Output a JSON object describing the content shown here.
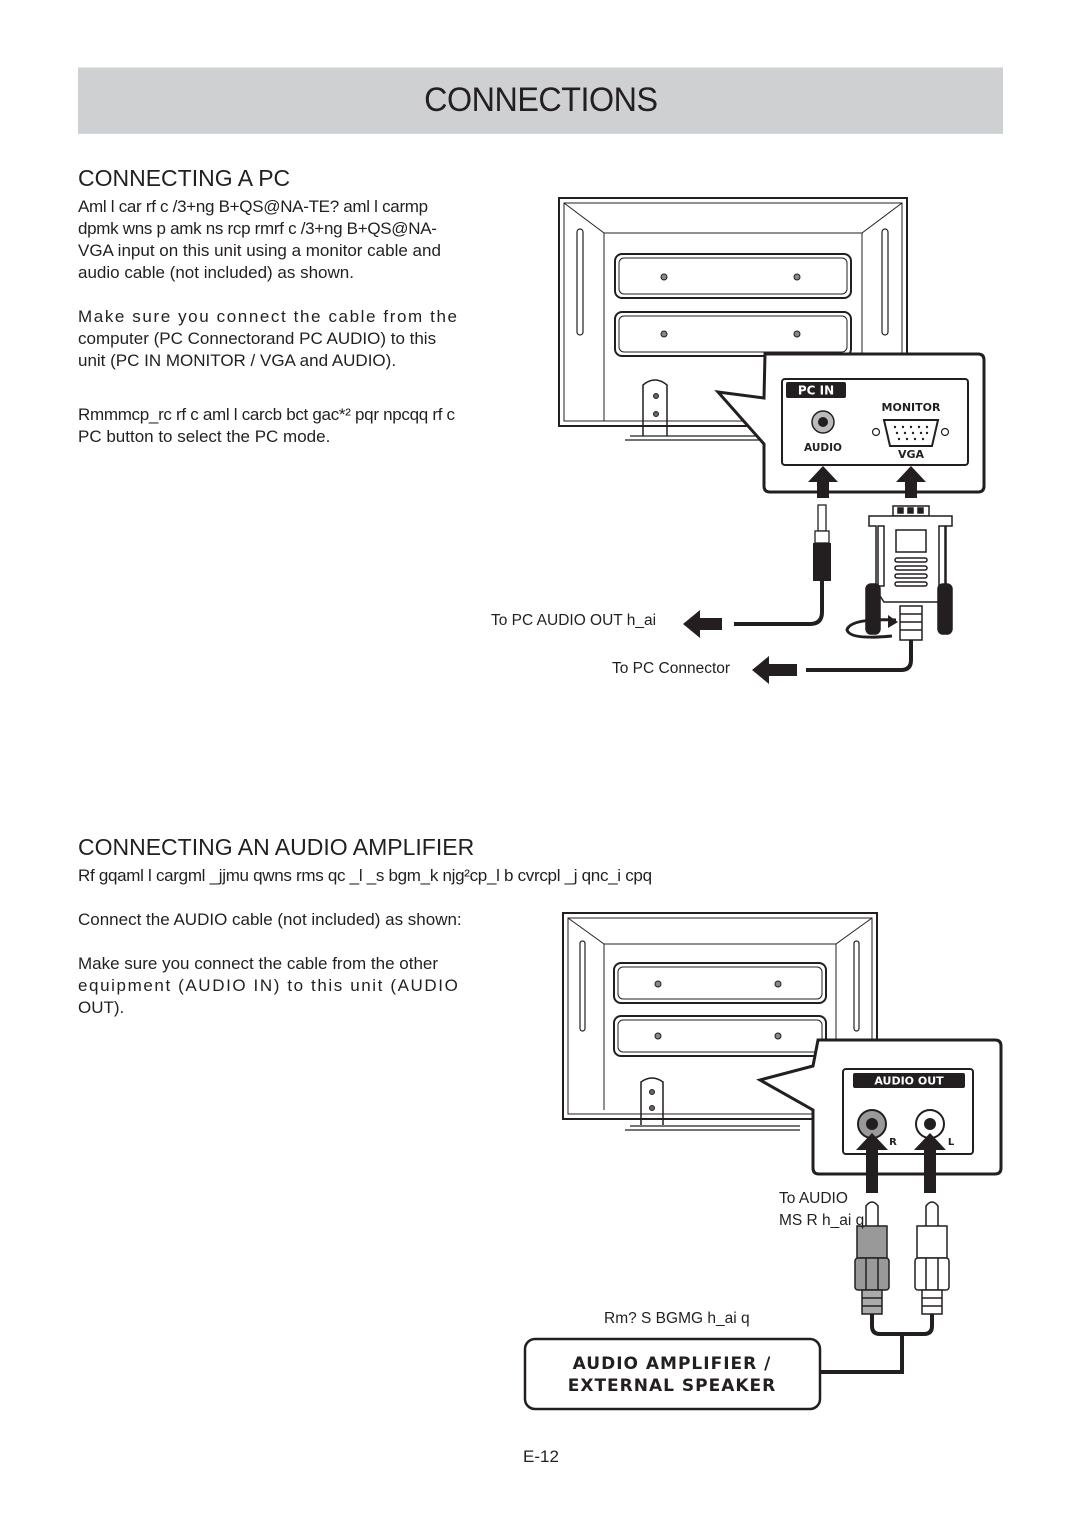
{
  "header": {
    "title": "CONNECTIONS"
  },
  "pc_section": {
    "heading": "CONNECTING A PC",
    "intro_lines": [
      "Aml l car rf c /3+ng  B+QS@NA-TE?  aml l carmp",
      "dpmk  wns p amk ns rcp rmrf c /3+ng  B+QS@NA-",
      "VGA input on this unit using a monitor cable and",
      "audio cable (not included) as shown."
    ],
    "make_sure_lines": [
      "Make sure you connect the cable from the",
      "computer (PC Connectorand PC AUDIO) to this",
      "unit (PC IN MONITOR / VGA and AUDIO)."
    ],
    "mode_lines": [
      "Rmmmcp_rc rf c aml l carcb bct gac*² pqr npcqq rf c",
      "PC button to select the PC mode."
    ],
    "panel": {
      "badge": "PC IN",
      "monitor_label": "MONITOR",
      "audio_label": "AUDIO",
      "vga_label": "VGA"
    },
    "callouts": {
      "audio_out": "To PC AUDIO OUT h_ai",
      "connector": "To PC Connector"
    }
  },
  "audio_section": {
    "heading": "CONNECTING AN AUDIO AMPLIFIER",
    "intro": "Rf gqaml l cargml _jjmu qwns rms qc _l  _s bgm_k njg²cp_l b cvrcpl _j qnc_i cpq",
    "connect_line": "Connect the AUDIO cable (not included) as shown:",
    "make_sure_lines": [
      "Make sure you connect the cable from the other",
      "equipment (AUDIO IN) to this unit (AUDIO",
      "OUT)."
    ],
    "panel": {
      "badge": "AUDIO  OUT",
      "r_label": "R",
      "l_label": "L"
    },
    "callouts": {
      "to_audio_line1": "To AUDIO",
      "to_audio_line2": "MS R h_ai q",
      "to_input": "Rm? S BGMG  h_ai q"
    },
    "amplifier_box": {
      "line1": "AUDIO AMPLIFIER /",
      "line2": "EXTERNAL SPEAKER"
    }
  },
  "footer": {
    "page_number": "E-12"
  }
}
